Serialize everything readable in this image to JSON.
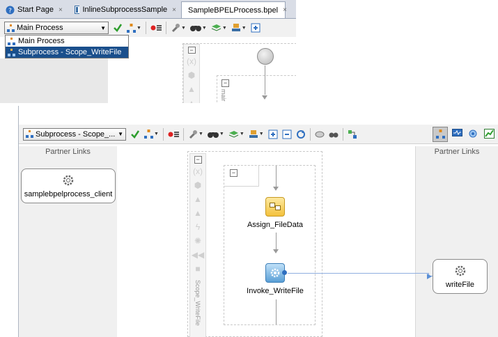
{
  "top_window": {
    "tabs": [
      {
        "label": "Start Page",
        "icon": "help-icon",
        "active": false
      },
      {
        "label": "InlineSubprocessSample",
        "icon": "project-icon",
        "active": false
      },
      {
        "label": "SampleBPELProcess.bpel",
        "icon": "process-icon",
        "active": true
      }
    ],
    "close_glyph": "×",
    "process_selector": {
      "value": "Main Process"
    },
    "dropdown_options": [
      "Main Process",
      "Subprocess - Scope_WriteFile"
    ],
    "scope_label": "mair"
  },
  "bottom_window": {
    "process_selector": {
      "value": "Subprocess - Scope_..."
    },
    "left_header": "Partner Links",
    "right_header": "Partner Links",
    "left_partner_link": "samplebpelprocess_client",
    "right_partner_link": "writeFile",
    "activities": [
      {
        "label": "Assign_FileData",
        "type": "assign"
      },
      {
        "label": "Invoke_WriteFile",
        "type": "invoke"
      }
    ],
    "scope_vertical_label": "Scope_WriteFile"
  },
  "colors": {
    "selection": "#1a4f8c",
    "check": "#2e9e2e",
    "tab_bar": "#d9dde6"
  }
}
